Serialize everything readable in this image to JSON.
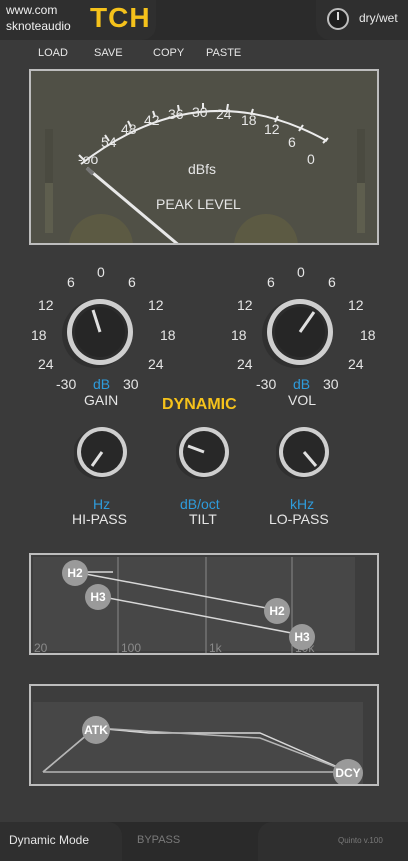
{
  "header": {
    "url": "www.com",
    "brand": "sknoteaudio",
    "title": "TCH",
    "mix_label": "dry/wet"
  },
  "presets": {
    "load": "LOAD",
    "save": "SAVE",
    "copy": "COPY",
    "paste": "PASTE"
  },
  "meter": {
    "scale": [
      "-oo",
      "54",
      "48",
      "42",
      "36",
      "30",
      "24",
      "18",
      "12",
      "6",
      "0"
    ],
    "unit": "dBfs",
    "label": "PEAK LEVEL"
  },
  "gain": {
    "scale": [
      "0",
      "6",
      "6",
      "12",
      "12",
      "18",
      "18",
      "24",
      "24",
      "-30",
      "30"
    ],
    "unit": "dB",
    "label": "GAIN"
  },
  "vol": {
    "scale": [
      "0",
      "6",
      "6",
      "12",
      "12",
      "18",
      "18",
      "24",
      "24",
      "-30",
      "30"
    ],
    "unit": "dB",
    "label": "VOL"
  },
  "dynamic_label": "DYNAMIC",
  "hipass": {
    "unit": "Hz",
    "label": "HI-PASS"
  },
  "tilt": {
    "unit": "dB/oct",
    "label": "TILT"
  },
  "lopass": {
    "unit": "kHz",
    "label": "LO-PASS"
  },
  "harmonics": {
    "freq_labels": [
      "20",
      "100",
      "1k",
      "10k"
    ],
    "h2_label": "H2",
    "h3_label": "H3"
  },
  "envelope": {
    "atk_label": "ATK",
    "dcy_label": "DCY"
  },
  "footer": {
    "mode": "Dynamic Mode",
    "bypass": "BYPASS",
    "version": "Quinto v.100"
  },
  "colors": {
    "accent": "#f5c21b",
    "unit_blue": "#2e9bdb",
    "panel_border": "#bdbdbd"
  }
}
